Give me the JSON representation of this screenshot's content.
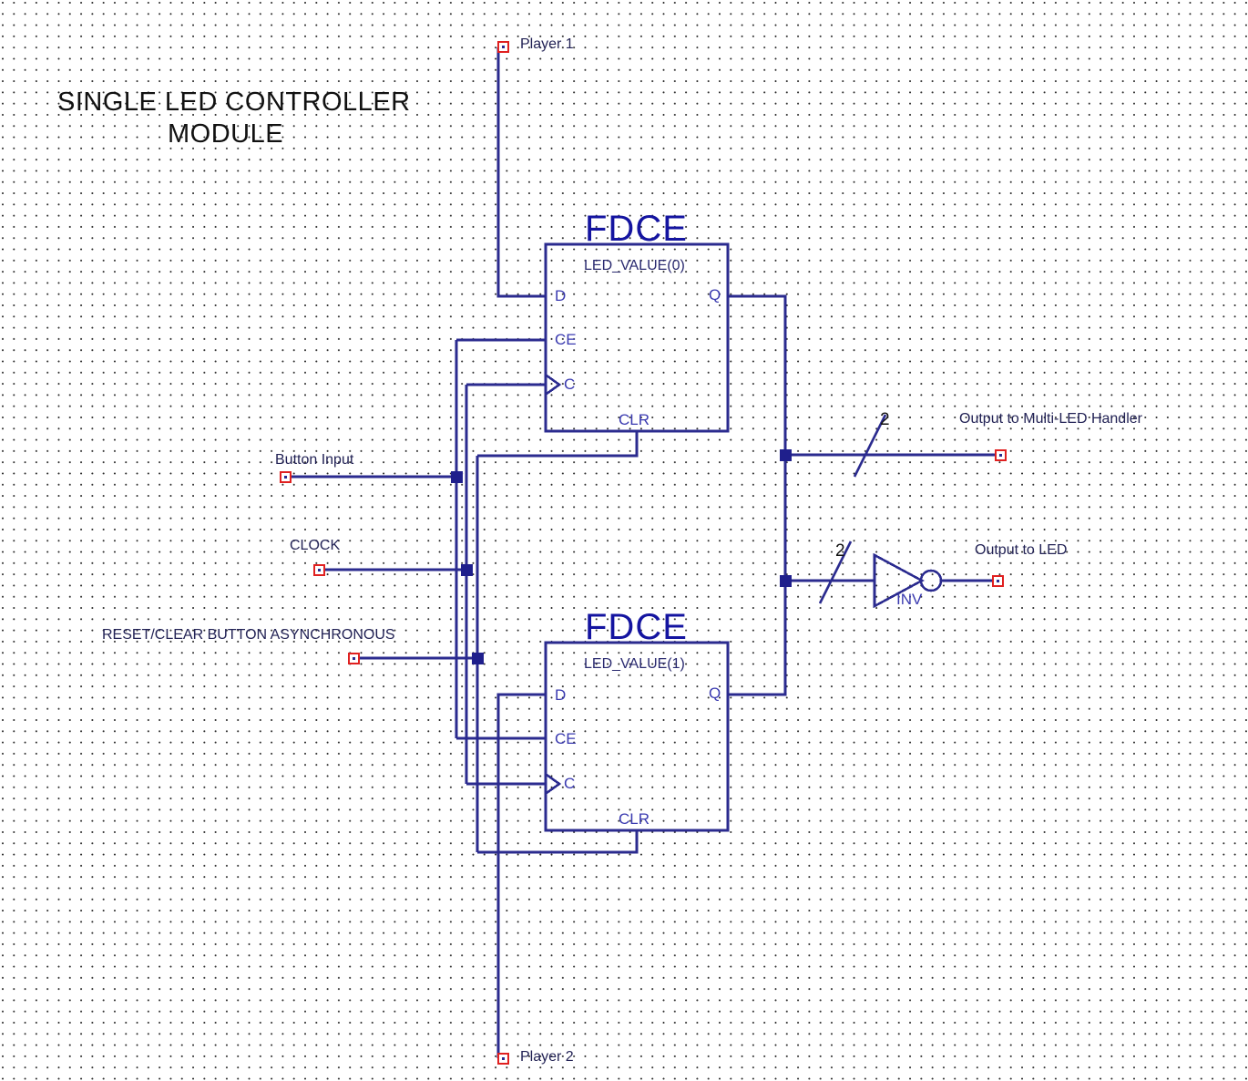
{
  "diagram": {
    "title_line1": "SINGLE LED CONTROLLER",
    "title_line2": "MODULE",
    "wire_color": "#2b2b8f",
    "marker_color": "#e02020",
    "label_color": "#1a1a6e"
  },
  "ports": {
    "player1": "Player 1",
    "player2": "Player 2",
    "button_input": "Button Input",
    "clock": "CLOCK",
    "reset": "RESET/CLEAR BUTTON ASYNCHRONOUS",
    "out_multi": "Output to Multi-LED Handler",
    "out_led": "Output to LED"
  },
  "blocks": [
    {
      "type": "FDCE",
      "instance": "LED_VALUE(0)",
      "pins": {
        "d": "D",
        "ce": "CE",
        "c": "C",
        "clr": "CLR",
        "q": "Q"
      }
    },
    {
      "type": "FDCE",
      "instance": "LED_VALUE(1)",
      "pins": {
        "d": "D",
        "ce": "CE",
        "c": "C",
        "clr": "CLR",
        "q": "Q"
      }
    }
  ],
  "inverter": {
    "label": "INV"
  },
  "bus_widths": {
    "multi": "2",
    "led": "2"
  }
}
